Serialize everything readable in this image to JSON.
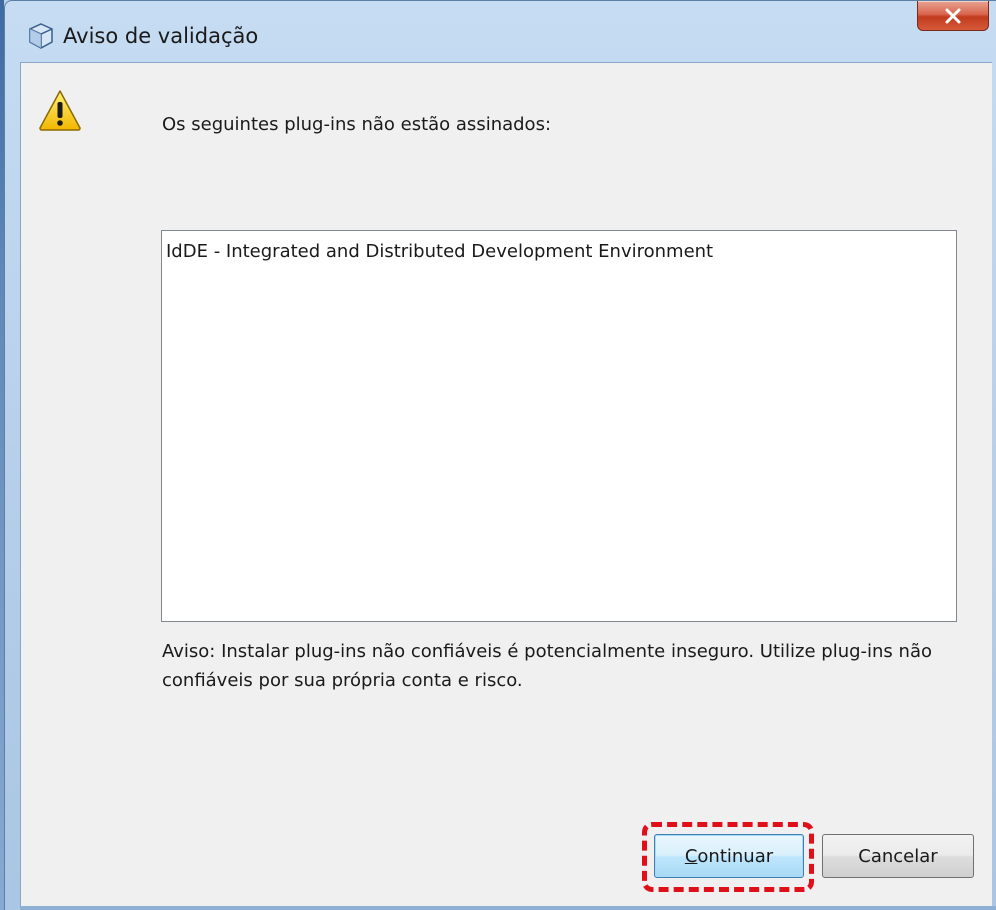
{
  "window": {
    "title": "Aviso de validação",
    "close_glyph": "X"
  },
  "dialog": {
    "header_message": "Os seguintes plug-ins não estão assinados:",
    "plugins": [
      "IdDE - Integrated and Distributed Development Environment"
    ],
    "warning_text": "Aviso: Instalar plug-ins não confiáveis é potencialmente inseguro. Utilize plug-ins não confiáveis por sua própria conta e risco."
  },
  "buttons": {
    "continue_mnemonic": "C",
    "continue_rest": "ontinuar",
    "cancel_label": "Cancelar"
  },
  "icons": {
    "app": "netbeans-cube-icon",
    "warning": "warning-triangle-icon",
    "close": "close-icon"
  },
  "colors": {
    "highlight": "#e0101a",
    "close_button": "#c23b1f",
    "dialog_background": "#f0f0f0",
    "frame": "#b9d1ea"
  }
}
